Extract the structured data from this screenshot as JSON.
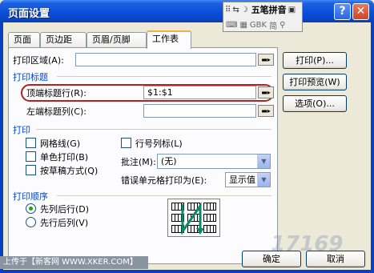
{
  "window": {
    "title": "页面设置"
  },
  "ime": {
    "name": "五笔拼音",
    "icons": [
      "GBK",
      "简"
    ]
  },
  "tabs": [
    {
      "label": "页面"
    },
    {
      "label": "页边距"
    },
    {
      "label": "页眉/页脚"
    },
    {
      "label": "工作表",
      "active": true
    }
  ],
  "sheet": {
    "print_area_label": "打印区域(A):",
    "print_area_value": "",
    "print_titles_group": "打印标题",
    "top_rows_label": "顶端标题行(R):",
    "top_rows_value": "$1:$1",
    "left_cols_label": "左端标题列(C):",
    "left_cols_value": "",
    "print_group": "打印",
    "gridlines": {
      "label": "网格线(G)",
      "checked": false
    },
    "mono": {
      "label": "单色打印(B)",
      "checked": false
    },
    "draft": {
      "label": "按草稿方式(Q)",
      "checked": false
    },
    "headings": {
      "label": "行号列标(L)",
      "checked": false
    },
    "comments_label": "批注(M):",
    "comments_value": "(无)",
    "errors_label": "错误单元格打印为(E):",
    "errors_value": "显示值",
    "order_group": "打印顺序",
    "down_then_over": {
      "label": "先列后行(D)",
      "selected": true
    },
    "over_then_down": {
      "label": "先行后列(V)",
      "selected": false
    }
  },
  "buttons": {
    "print": "打印(P)...",
    "preview": "打印预览(W)",
    "options": "选项(O)...",
    "ok": "确定",
    "cancel": "取消"
  },
  "watermark": {
    "caption": "上传于【新客网 WWW.XKER.COM】",
    "logo": "17169"
  }
}
